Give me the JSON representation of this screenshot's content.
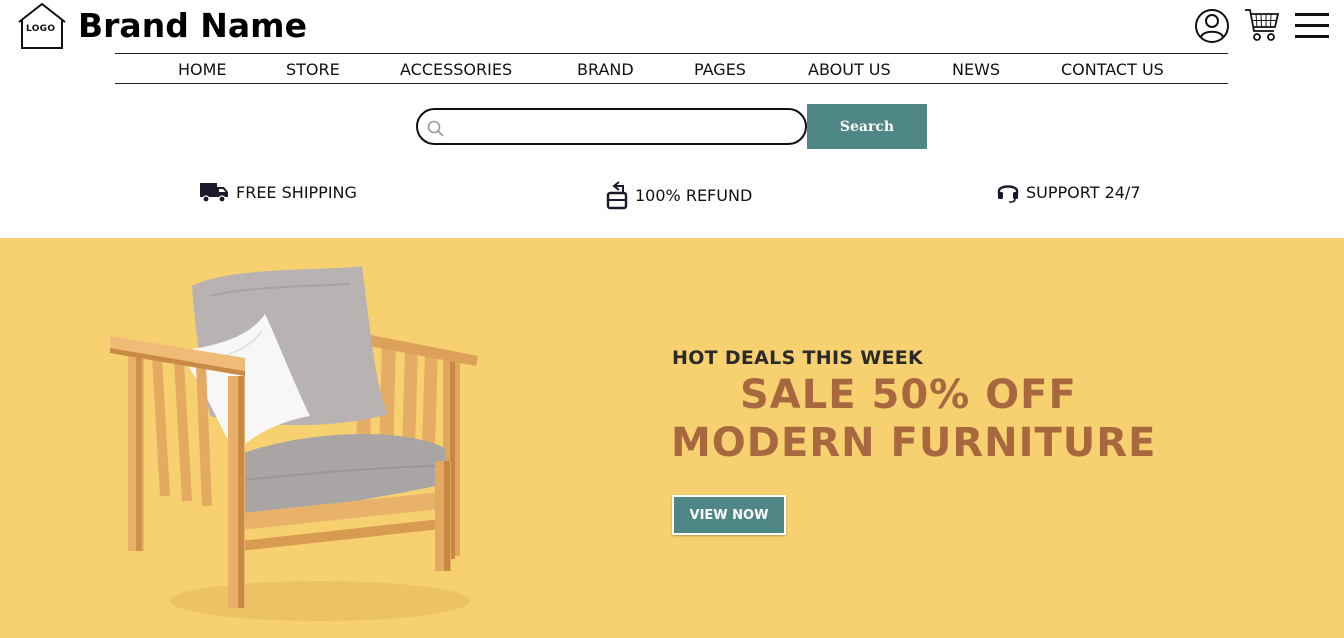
{
  "header": {
    "logo_text": "LOGO",
    "brand_name": "Brand Name",
    "icons": [
      "user-icon",
      "cart-icon",
      "menu-icon"
    ]
  },
  "nav": {
    "items": [
      "HOME",
      "STORE",
      "ACCESSORIES",
      "BRAND",
      "PAGES",
      "ABOUT US",
      "NEWS",
      "CONTACT US"
    ]
  },
  "search": {
    "value": "",
    "placeholder": "",
    "button_label": "Search"
  },
  "features": {
    "shipping": "FREE SHIPPING",
    "refund": "100% REFUND",
    "support": "SUPPORT 24/7"
  },
  "hero": {
    "subtitle": "HOT DEALS THIS WEEK",
    "title_line1": "SALE 50% OFF",
    "title_line2": "MODERN FURNITURE",
    "button_label": "VIEW NOW"
  },
  "colors": {
    "accent": "#4e8786",
    "hero_bg": "#f7d170",
    "hero_title": "#a8683f"
  }
}
